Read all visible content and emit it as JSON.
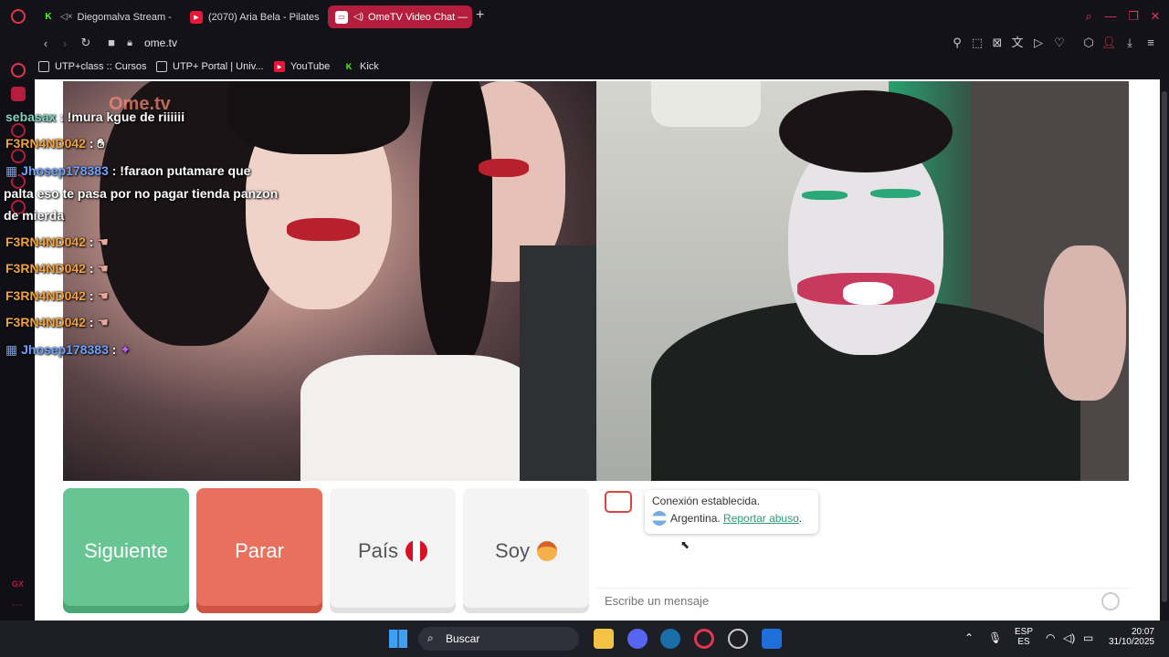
{
  "tabs": [
    {
      "label": "Diegomalva Stream - ",
      "favicon": "kick-icon"
    },
    {
      "label": "(2070) Aria Bela - Pilates",
      "favicon": "youtube-icon"
    },
    {
      "label": "OmeTV Video Chat —",
      "favicon": "ometv-icon"
    }
  ],
  "address": {
    "url": "ome.tv"
  },
  "bookmarks": [
    {
      "label": "UTP+class :: Cursos"
    },
    {
      "label": "UTP+ Portal | Univ..."
    },
    {
      "label": "YouTube"
    },
    {
      "label": "Kick"
    }
  ],
  "chat_overlay": [
    {
      "user": "sebasax",
      "text": ": !mura kgue de riiiiii"
    },
    {
      "user": "F3RN4ND042",
      "text": ":"
    },
    {
      "user": "Jhosep178383",
      "text": ": !faraon putamare que"
    },
    {
      "user": "",
      "text": "palta eso te pasa por no pagar tienda panzon"
    },
    {
      "user": "",
      "text": "de mierda"
    },
    {
      "user": "F3RN4ND042",
      "text": ":"
    },
    {
      "user": "F3RN4ND042",
      "text": ":"
    },
    {
      "user": "F3RN4ND042",
      "text": ":"
    },
    {
      "user": "F3RN4ND042",
      "text": ":"
    },
    {
      "user": "Jhosep178383",
      "text": ":"
    }
  ],
  "watermark": "Ome.tv",
  "buttons": {
    "next": "Siguiente",
    "stop": "Parar",
    "country": "País",
    "soy": "Soy"
  },
  "chat": {
    "status": "Conexión establecida.",
    "country": "Argentina.",
    "report": "Reportar abuso",
    "input_placeholder": "Escribe un mensaje"
  },
  "taskbar": {
    "search_label": "Buscar",
    "lang_top": "ESP",
    "lang_bottom": "ES",
    "time": "20:07",
    "date": "31/10/2025"
  },
  "colors": {
    "accent": "#b51d3d",
    "next_button": "#66c592",
    "stop_button": "#e8705d"
  }
}
